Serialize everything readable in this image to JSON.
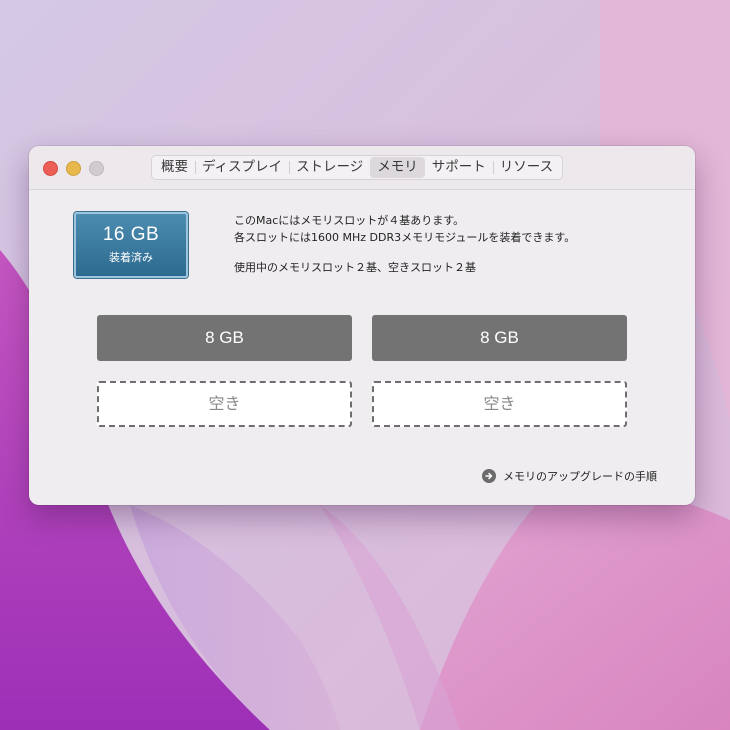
{
  "window": {
    "tabs": [
      {
        "label": "概要"
      },
      {
        "label": "ディスプレイ"
      },
      {
        "label": "ストレージ"
      },
      {
        "label": "メモリ",
        "active": true
      },
      {
        "label": "サポート"
      },
      {
        "label": "リソース"
      }
    ]
  },
  "badge": {
    "size": "16 GB",
    "label": "装着済み",
    "color": "#3a7aa0"
  },
  "info": {
    "line1": "このMacにはメモリスロットが４基あります。",
    "line2": "各スロットには1600 MHz DDR3メモリモジュールを装着できます。",
    "line3": "使用中のメモリスロット２基、空きスロット２基"
  },
  "slots": [
    {
      "label": "8 GB",
      "state": "filled"
    },
    {
      "label": "8 GB",
      "state": "filled"
    },
    {
      "label": "空き",
      "state": "empty"
    },
    {
      "label": "空き",
      "state": "empty"
    }
  ],
  "upgrade_link": {
    "label": "メモリのアップグレードの手順",
    "icon": "arrow-right-circle-icon"
  },
  "colors": {
    "close": "#ec5f57",
    "minimize": "#e7b84c",
    "zoom": "#cfcbcf",
    "slot_filled": "#737373"
  }
}
